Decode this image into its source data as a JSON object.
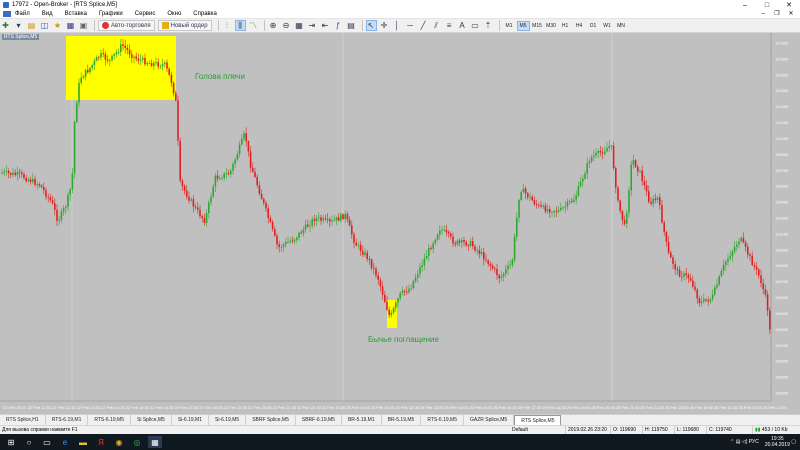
{
  "window": {
    "title": "17972 - Open-Broker - [RTS Splice,M5]"
  },
  "menu": [
    "Файл",
    "Вид",
    "Вставка",
    "Графики",
    "Сервис",
    "Окно",
    "Справка"
  ],
  "toolbar": {
    "auto_trading": "Авто-торговля",
    "new_order": "Новый ордер",
    "timeframes": [
      "M1",
      "M5",
      "M15",
      "M30",
      "H1",
      "H4",
      "D1",
      "W1",
      "MN"
    ],
    "active_timeframe": "M5"
  },
  "chart": {
    "label": "RTS Splice,M5",
    "annotation_top": "Голова плечи",
    "annotation_bottom": "Бычье поглащение",
    "annotation_color": "#2e9a36",
    "highlight_color": "#ffff00",
    "bull_color": "#2ea82e",
    "bear_color": "#e02020",
    "price_labels": [
      "121950",
      "121800",
      "121650",
      "121500",
      "121350",
      "121200",
      "121050",
      "120900",
      "120750",
      "120600",
      "120450",
      "120300",
      "120150",
      "120000",
      "119850",
      "119700",
      "119550",
      "119400",
      "119250",
      "119100",
      "118950",
      "118800",
      "118650"
    ],
    "time_labels": [
      "22 Feb 2019",
      "22 Feb 11:30",
      "22 Feb 12:30",
      "22 Feb 13:30",
      "22 Feb 14:30",
      "22 Feb 15:30",
      "22 Feb 16:30",
      "22 Feb 17:30",
      "22 Feb 18:30",
      "22 Feb 19:30",
      "22 Feb 20:30",
      "22 Feb 21:30",
      "22 Feb 22:30",
      "22 Feb 23:30",
      "25 Feb 10:00",
      "25 Feb 11:00",
      "25 Feb 12:00",
      "25 Feb 13:00",
      "25 Feb 14:00",
      "25 Feb 15:00",
      "25 Feb 16:00",
      "25 Feb 17:00",
      "25 Feb 18:00",
      "25 Feb 19:00",
      "25 Feb 20:00",
      "25 Feb 21:00",
      "25 Feb 22:00",
      "25 Feb 23:00",
      "26 Feb 10:00",
      "26 Feb 11:00",
      "26 Feb 12:00",
      "26 Feb 13:00"
    ]
  },
  "tabs": [
    "RTS Splice,H1",
    "RTS-6.19,M1",
    "RTS-6.19,M5",
    "Si Splice,M5",
    "Si-6.19,M1",
    "Si-6.19,M5",
    "SBRF Splice,M5",
    "SBRF-6.19,M5",
    "BR-5.19,M1",
    "BR-5.19,M5",
    "RTS-6.19,M5",
    "GAZR Splice,M5",
    "RTS Splice,M5"
  ],
  "active_tab": "RTS Splice,M5",
  "status": {
    "help": "Для вызова справки нажмите F1",
    "profile": "Default",
    "datetime": "2019.02.26 23:20",
    "open": "O: 119690",
    "high": "H: 119750",
    "low": "L: 119680",
    "close": "C: 119740",
    "conn": "453 / 10 Kb"
  },
  "taskbar": {
    "time": "19:35",
    "date": "20.04.2019",
    "lang": "РУС"
  }
}
